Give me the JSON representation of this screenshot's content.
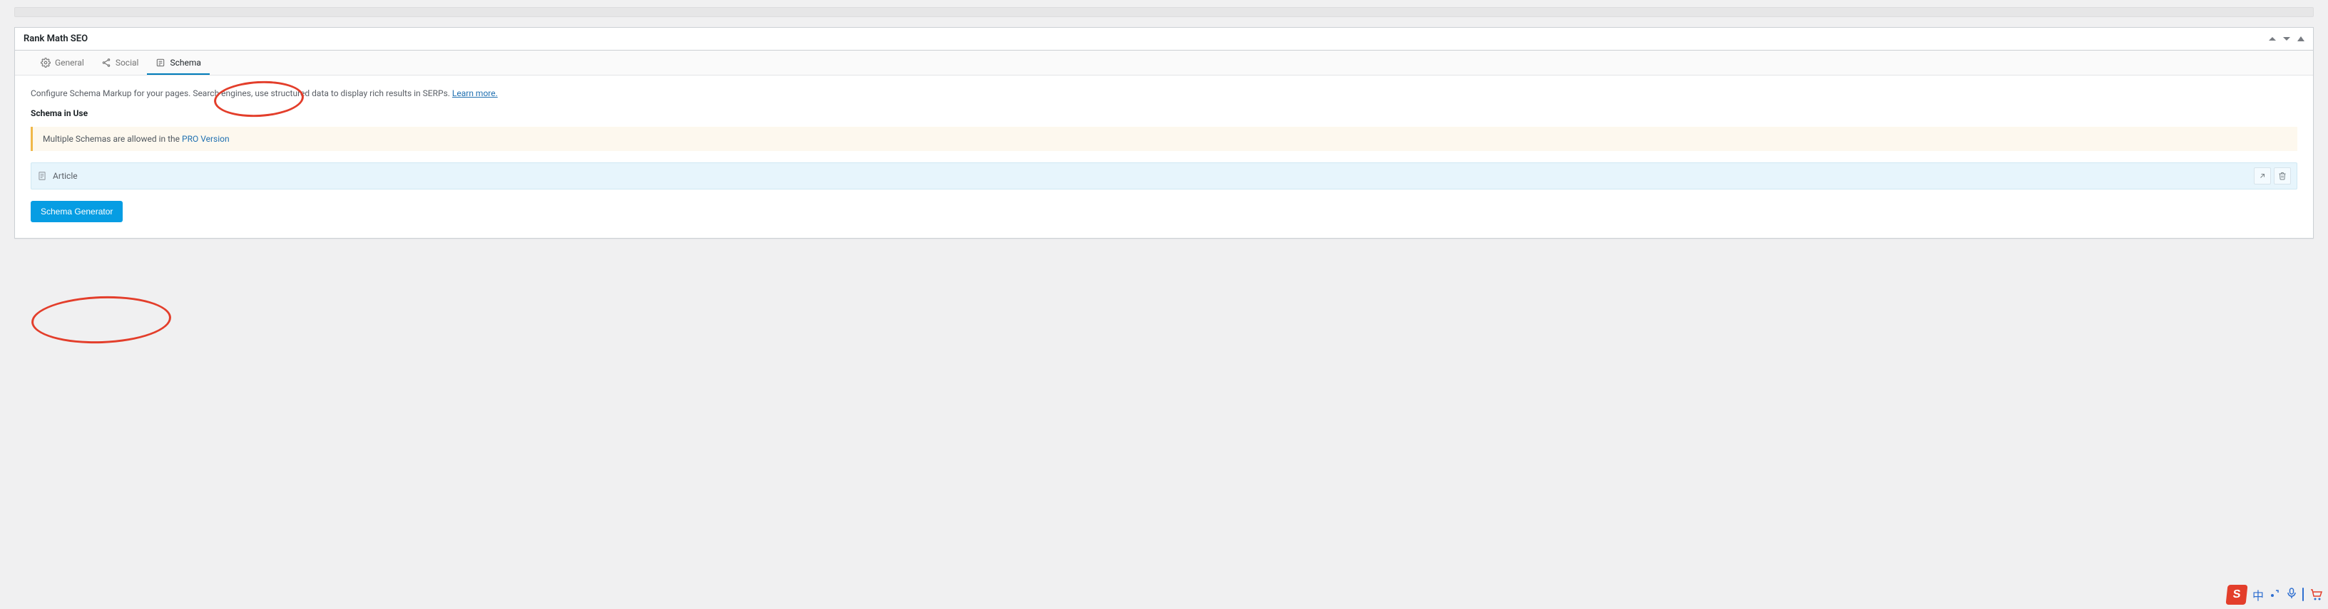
{
  "panel": {
    "title": "Rank Math SEO"
  },
  "tabs": {
    "general": "General",
    "social": "Social",
    "schema": "Schema"
  },
  "schema": {
    "description_prefix": "Configure Schema Markup for your pages. Search engines, use structured data to display rich results in SERPs. ",
    "learn_more": "Learn more.",
    "in_use_heading": "Schema in Use",
    "notice_prefix": "Multiple Schemas are allowed in the ",
    "notice_link": "PRO Version",
    "current_type": "Article",
    "generator_button": "Schema Generator"
  },
  "ime": {
    "logo": "S",
    "lang": "中",
    "mic": "🎤",
    "cart_color_a": "#e33e2b",
    "cart_color_b": "#2f6fd0"
  }
}
